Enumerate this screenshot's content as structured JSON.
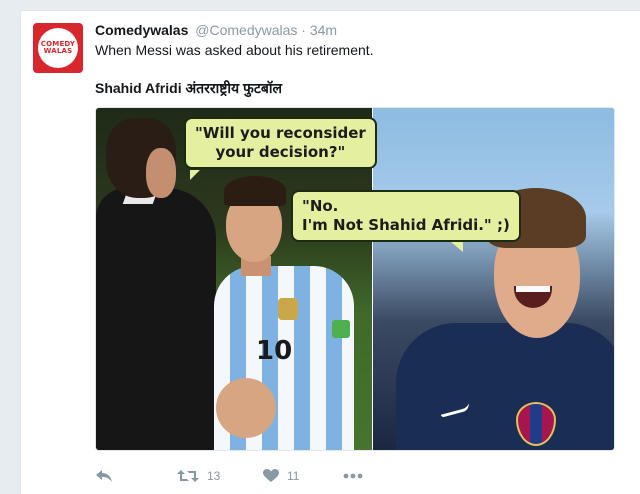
{
  "tweet": {
    "avatar": {
      "line1": "COMEDY",
      "line2": "WALAS",
      "bg_color": "#d7262c"
    },
    "display_name": "Comedywalas",
    "handle": "@Comedywalas",
    "separator": "·",
    "time": "34m",
    "text": "When Messi was asked about his retirement.",
    "subtitle": "Shahid Afridi अंतरराष्ट्रीय फुटबॉल",
    "media": {
      "bubble_question_line1": "\"Will you reconsider",
      "bubble_question_line2": "your decision?\"",
      "bubble_answer_line1": "\"No.",
      "bubble_answer_line2": "I'm Not Shahid Afridi.\" ;)",
      "shirt_number": "10"
    },
    "actions": {
      "reply_icon": "reply-icon",
      "retweet_icon": "retweet-icon",
      "retweet_count": "13",
      "like_icon": "heart-icon",
      "like_count": "11",
      "more_icon": "more-icon"
    }
  },
  "colors": {
    "background": "#e6ecf0",
    "card": "#ffffff",
    "muted_text": "#8899a6",
    "bubble_fill": "#e4ef9f"
  }
}
